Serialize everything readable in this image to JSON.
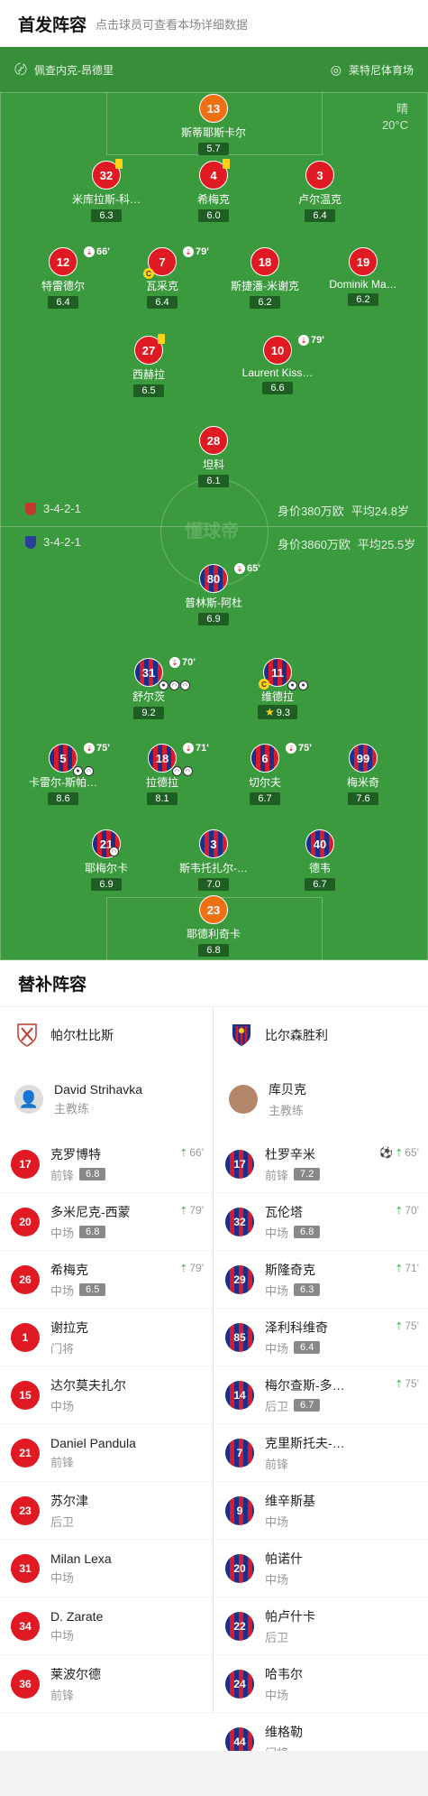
{
  "header": {
    "title": "首发阵容",
    "subtitle": "点击球员可查看本场详细数据"
  },
  "venue": {
    "left": "佩查内克-昂德里",
    "right": "莱特尼体育场"
  },
  "weather": {
    "condition": "晴",
    "temp": "20°C"
  },
  "home_info": {
    "formation": "3-4-2-1",
    "value": "身价380万欧",
    "age": "平均24.8岁"
  },
  "away_info": {
    "formation": "3-4-2-1",
    "value": "身价3860万欧",
    "age": "平均25.5岁"
  },
  "watermark": "懂球帝",
  "home_players": [
    {
      "num": "13",
      "name": "斯蒂耶斯卡尔",
      "rating": "5.7"
    },
    {
      "num": "32",
      "name": "米库拉斯-科…",
      "rating": "6.3"
    },
    {
      "num": "4",
      "name": "希梅克",
      "rating": "6.0"
    },
    {
      "num": "3",
      "name": "卢尔温克",
      "rating": "6.4"
    },
    {
      "num": "12",
      "name": "特雷德尔",
      "rating": "6.4",
      "sub": "66'"
    },
    {
      "num": "7",
      "name": "瓦采克",
      "rating": "6.4",
      "sub": "79'",
      "captain": "C"
    },
    {
      "num": "18",
      "name": "斯捷潘-米谢克",
      "rating": "6.2"
    },
    {
      "num": "19",
      "name": "Dominik Ma…",
      "rating": "6.2"
    },
    {
      "num": "27",
      "name": "西赫拉",
      "rating": "6.5"
    },
    {
      "num": "10",
      "name": "Laurent Kiss…",
      "rating": "6.6",
      "sub": "79'"
    },
    {
      "num": "28",
      "name": "坦科",
      "rating": "6.1"
    }
  ],
  "away_players": [
    {
      "num": "80",
      "name": "普林斯-阿杜",
      "rating": "6.9",
      "sub": "65'"
    },
    {
      "num": "31",
      "name": "舒尔茨",
      "rating": "9.2",
      "sub": "70'"
    },
    {
      "num": "11",
      "name": "维德拉",
      "rating": "9.3",
      "captain": "C"
    },
    {
      "num": "5",
      "name": "卡雷尔-斯帕…",
      "rating": "8.6",
      "sub": "75'"
    },
    {
      "num": "18",
      "name": "拉德拉",
      "rating": "8.1",
      "sub": "71'"
    },
    {
      "num": "6",
      "name": "切尔夫",
      "rating": "6.7",
      "sub": "75'"
    },
    {
      "num": "99",
      "name": "梅米奇",
      "rating": "7.6"
    },
    {
      "num": "21",
      "name": "耶梅尔卡",
      "rating": "6.9"
    },
    {
      "num": "3",
      "name": "斯韦托扎尔-…",
      "rating": "7.0"
    },
    {
      "num": "40",
      "name": "德韦",
      "rating": "6.7"
    },
    {
      "num": "23",
      "name": "耶德利奇卡",
      "rating": "6.8"
    }
  ],
  "subs": {
    "title": "替补阵容",
    "home_team": "帕尔杜比斯",
    "away_team": "比尔森胜利",
    "home_coach": {
      "name": "David Strihavka",
      "role": "主教练"
    },
    "away_coach": {
      "name": "库贝克",
      "role": "主教练"
    },
    "home": [
      {
        "num": "17",
        "name": "克罗博特",
        "pos": "前锋",
        "rating": "6.8",
        "time": "66'"
      },
      {
        "num": "20",
        "name": "多米尼克-西蒙",
        "pos": "中场",
        "rating": "6.8",
        "time": "79'"
      },
      {
        "num": "26",
        "name": "希梅克",
        "pos": "中场",
        "rating": "6.5",
        "time": "79'"
      },
      {
        "num": "1",
        "name": "谢拉克",
        "pos": "门将"
      },
      {
        "num": "15",
        "name": "达尔莫夫扎尔",
        "pos": "中场"
      },
      {
        "num": "21",
        "name": "Daniel Pandula",
        "pos": "前锋"
      },
      {
        "num": "23",
        "name": "苏尔津",
        "pos": "后卫"
      },
      {
        "num": "31",
        "name": "Milan Lexa",
        "pos": "中场"
      },
      {
        "num": "34",
        "name": "D. Zarate",
        "pos": "中场"
      },
      {
        "num": "36",
        "name": "莱波尔德",
        "pos": "前锋"
      }
    ],
    "away": [
      {
        "num": "17",
        "name": "杜罗辛米",
        "pos": "前锋",
        "rating": "7.2",
        "time": "65'",
        "goal": true
      },
      {
        "num": "32",
        "name": "瓦伦塔",
        "pos": "中场",
        "rating": "6.8",
        "time": "70'"
      },
      {
        "num": "29",
        "name": "斯隆奇克",
        "pos": "中场",
        "rating": "6.3",
        "time": "71'"
      },
      {
        "num": "85",
        "name": "泽利科维奇",
        "pos": "中场",
        "rating": "6.4",
        "time": "75'"
      },
      {
        "num": "14",
        "name": "梅尔查斯-多…",
        "pos": "后卫",
        "rating": "6.7",
        "time": "75'"
      },
      {
        "num": "7",
        "name": "克里斯托夫-…",
        "pos": "前锋"
      },
      {
        "num": "9",
        "name": "维辛斯基",
        "pos": "中场"
      },
      {
        "num": "20",
        "name": "帕诺什",
        "pos": "中场"
      },
      {
        "num": "22",
        "name": "帕卢什卡",
        "pos": "后卫"
      },
      {
        "num": "24",
        "name": "哈韦尔",
        "pos": "中场"
      },
      {
        "num": "44",
        "name": "维格勒",
        "pos": "门将"
      }
    ]
  }
}
